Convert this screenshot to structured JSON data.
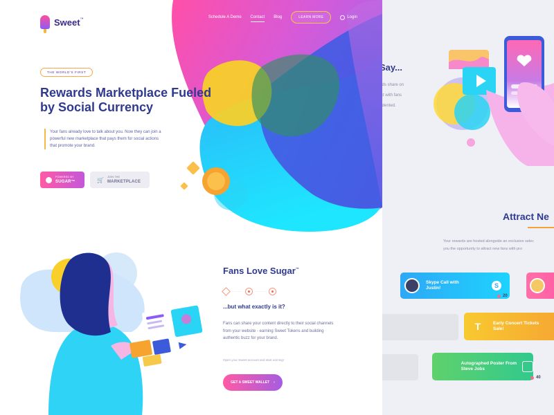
{
  "brand": {
    "name": "Sweet",
    "mark": "™"
  },
  "nav": {
    "items": [
      "Schedule A Demo",
      "Contact",
      "Blog"
    ],
    "cta": "LEARN MORE",
    "login": "Login"
  },
  "hero": {
    "badge": "THE WORLD'S FIRST",
    "headline": "Rewards Marketplace Fueled by Social Currency",
    "description": "Your fans already love to talk about you. Now they can join a powerful new marketplace that pays them for social actions that promote your brand.",
    "btn_sugar_small": "POWERED BY",
    "btn_sugar_big": "SUGAR™",
    "btn_market_small": "JOIN THE",
    "btn_market_big": "MARKETPLACE"
  },
  "fans": {
    "title": "Fans Love Sugar",
    "tm": "™",
    "subheading": "...but what exactly is it?",
    "body": "Fans can share your content directly to their social channels from your website - earning Sweet Tokens and building authentic buzz for your brand.",
    "hint": "Open your Sweet account and start earning!",
    "cta": "GET A SWEET WALLET",
    "dots": "·····"
  },
  "right": {
    "heading_fragment": "Say...",
    "text_fragment": "friends share on\nnnect with fans\nrecedented.",
    "attract": "Attract Ne",
    "para": "Your rewards are hosted alongside an exclusive selec\nyou the opportunity to attract new fans with pro",
    "cards": [
      {
        "title": "Skype Call with Justin!",
        "count": "20"
      },
      {
        "title": "Early Concert Tickets Sale!"
      },
      {
        "title": "Autographed Poster From Steve Jobs",
        "count": "40"
      }
    ]
  },
  "colors": {
    "navy": "#2f3a8f",
    "pink": "#ff5aa5",
    "orange": "#f6a84a",
    "cyan": "#2ad4f5",
    "purple": "#8b5cf6"
  }
}
